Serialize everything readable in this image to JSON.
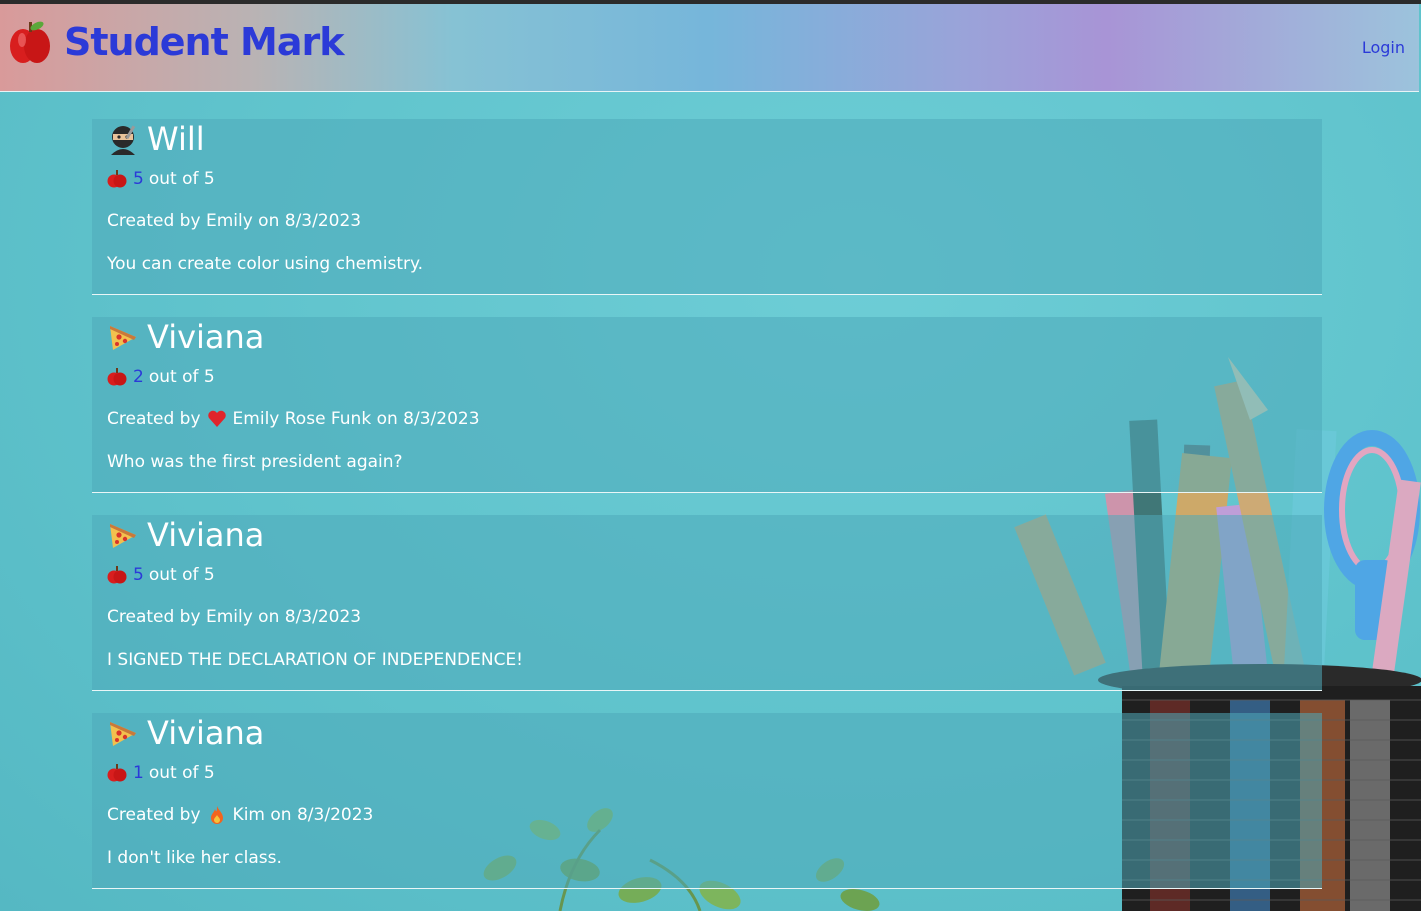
{
  "app": {
    "brand_title": "Student Mark",
    "brand_icon": "apple-icon",
    "login_label": "Login"
  },
  "colors": {
    "accent": "#2b3ad8",
    "card_bg": "#4eaab9",
    "page_bg": "#5fc3cc"
  },
  "labels": {
    "out_of": "out of 5",
    "created_by": "Created by",
    "on": "on"
  },
  "posts": [
    {
      "name": "Will",
      "icon": "ninja-icon",
      "score": "5",
      "author": "Emily",
      "author_icon": "",
      "date": "8/3/2023",
      "message": "You can create color using chemistry."
    },
    {
      "name": "Viviana",
      "icon": "pizza-icon",
      "score": "2",
      "author": "Emily Rose Funk",
      "author_icon": "heart-icon",
      "date": "8/3/2023",
      "message": "Who was the first president again?"
    },
    {
      "name": "Viviana",
      "icon": "pizza-icon",
      "score": "5",
      "author": "Emily",
      "author_icon": "",
      "date": "8/3/2023",
      "message": "I SIGNED THE DECLARATION OF INDEPENDENCE!"
    },
    {
      "name": "Viviana",
      "icon": "pizza-icon",
      "score": "1",
      "author": "Kim",
      "author_icon": "fire-icon",
      "date": "8/3/2023",
      "message": "I don't like her class."
    }
  ]
}
